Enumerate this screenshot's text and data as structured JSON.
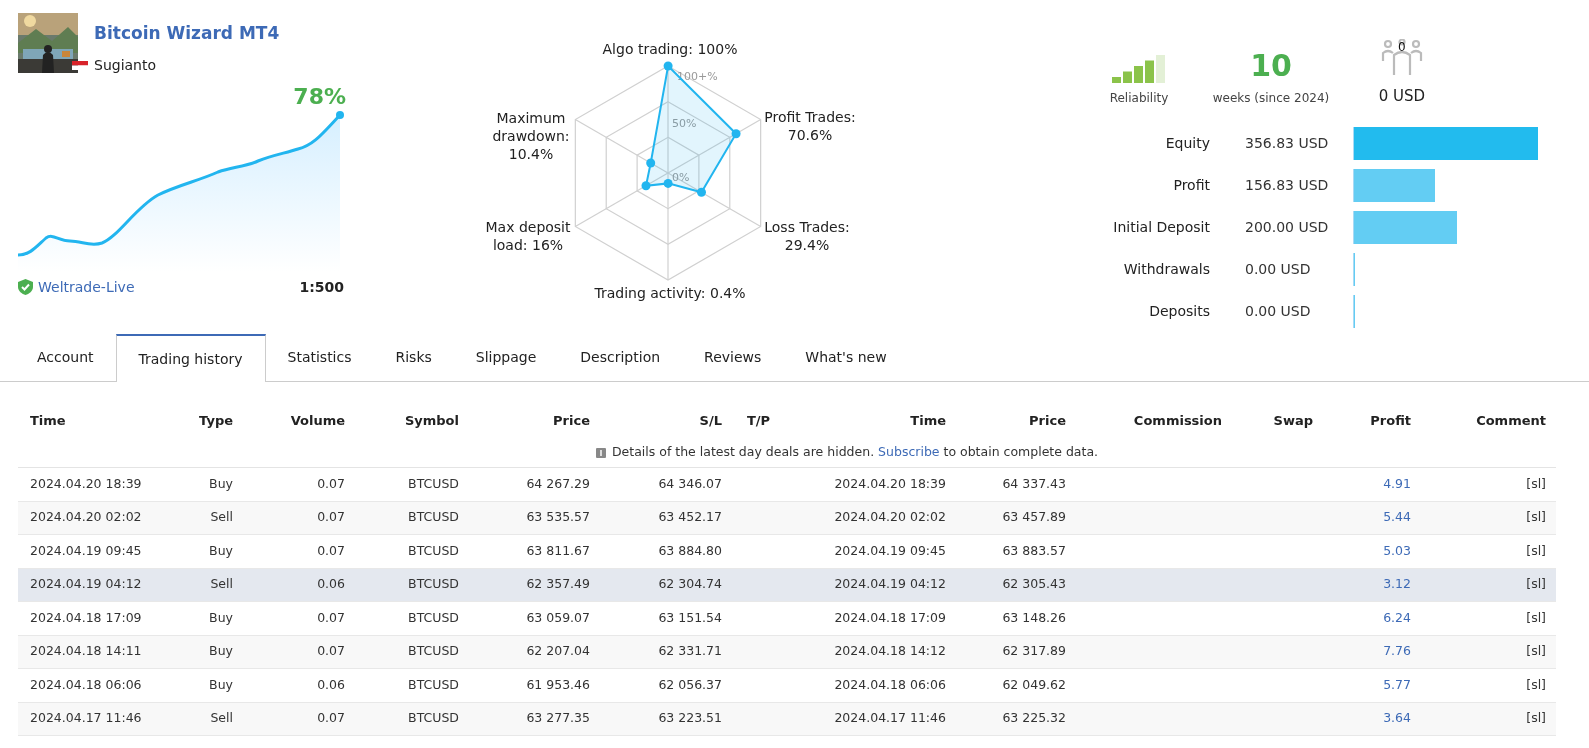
{
  "signal": {
    "title": "Bitcoin Wizard MT4",
    "author": "Sugianto",
    "growth": "78%",
    "server": "Weltrade-Live",
    "leverage": "1:500"
  },
  "radar": {
    "scale_labels": [
      "100+%",
      "50%",
      "0%"
    ],
    "axes": [
      {
        "label": "Algo trading: 100%"
      },
      {
        "label": "Maximum drawdown: 10.4%"
      },
      {
        "label": "Profit Trades: 70.6%"
      },
      {
        "label": "Max deposit load: 16%"
      },
      {
        "label": "Loss Trades: 29.4%"
      },
      {
        "label": "Trading activity: 0.4%"
      }
    ]
  },
  "stats": {
    "reliability": "Reliability",
    "weeks": "10",
    "weeks_label": "weeks (since 2024)",
    "subscribers": "0",
    "subscribers_amount": "0 USD"
  },
  "balances": [
    {
      "label": "Equity",
      "value": "356.83 USD",
      "level": 1.0,
      "color": "#22bbee"
    },
    {
      "label": "Profit",
      "value": "156.83 USD",
      "level": 0.44,
      "color": "#63cdf3"
    },
    {
      "label": "Initial Deposit",
      "value": "200.00 USD",
      "level": 0.56,
      "color": "#63cdf3"
    },
    {
      "label": "Withdrawals",
      "value": "0.00 USD",
      "level": 0,
      "color": "#63cdf3"
    },
    {
      "label": "Deposits",
      "value": "0.00 USD",
      "level": 0,
      "color": "#63cdf3"
    }
  ],
  "tabs": [
    {
      "label": "Account",
      "selected": false
    },
    {
      "label": "Trading history",
      "selected": true
    },
    {
      "label": "Statistics",
      "selected": false
    },
    {
      "label": "Risks",
      "selected": false
    },
    {
      "label": "Slippage",
      "selected": false
    },
    {
      "label": "Description",
      "selected": false
    },
    {
      "label": "Reviews",
      "selected": false
    },
    {
      "label": "What's new",
      "selected": false
    }
  ],
  "table": {
    "columns": [
      "Time",
      "Type",
      "Volume",
      "Symbol",
      "Price",
      "S/L",
      "T/P",
      "Time",
      "Price",
      "Commission",
      "Swap",
      "Profit",
      "Comment"
    ],
    "notice": {
      "before": "Details of the latest day deals are hidden.",
      "link": "Subscribe",
      "after": "to obtain complete data."
    },
    "rows": [
      {
        "selected": false,
        "cells": [
          "2024.04.20 18:39",
          "Buy",
          "0.07",
          "BTCUSD",
          "64 267.29",
          "64 346.07",
          "",
          "2024.04.20 18:39",
          "64 337.43",
          "",
          "",
          "4.91",
          "[sl]"
        ]
      },
      {
        "selected": false,
        "cells": [
          "2024.04.20 02:02",
          "Sell",
          "0.07",
          "BTCUSD",
          "63 535.57",
          "63 452.17",
          "",
          "2024.04.20 02:02",
          "63 457.89",
          "",
          "",
          "5.44",
          "[sl]"
        ]
      },
      {
        "selected": false,
        "cells": [
          "2024.04.19 09:45",
          "Buy",
          "0.07",
          "BTCUSD",
          "63 811.67",
          "63 884.80",
          "",
          "2024.04.19 09:45",
          "63 883.57",
          "",
          "",
          "5.03",
          "[sl]"
        ]
      },
      {
        "selected": true,
        "cells": [
          "2024.04.19 04:12",
          "Sell",
          "0.06",
          "BTCUSD",
          "62 357.49",
          "62 304.74",
          "",
          "2024.04.19 04:12",
          "62 305.43",
          "",
          "",
          "3.12",
          "[sl]"
        ]
      },
      {
        "selected": false,
        "cells": [
          "2024.04.18 17:09",
          "Buy",
          "0.07",
          "BTCUSD",
          "63 059.07",
          "63 151.54",
          "",
          "2024.04.18 17:09",
          "63 148.26",
          "",
          "",
          "6.24",
          "[sl]"
        ]
      },
      {
        "selected": false,
        "cells": [
          "2024.04.18 14:11",
          "Buy",
          "0.07",
          "BTCUSD",
          "62 207.04",
          "62 331.71",
          "",
          "2024.04.18 14:12",
          "62 317.89",
          "",
          "",
          "7.76",
          "[sl]"
        ]
      },
      {
        "selected": false,
        "cells": [
          "2024.04.18 06:06",
          "Buy",
          "0.06",
          "BTCUSD",
          "61 953.46",
          "62 056.37",
          "",
          "2024.04.18 06:06",
          "62 049.62",
          "",
          "",
          "5.77",
          "[sl]"
        ]
      },
      {
        "selected": false,
        "cells": [
          "2024.04.17 11:46",
          "Sell",
          "0.07",
          "BTCUSD",
          "63 277.35",
          "63 223.51",
          "",
          "2024.04.17 11:46",
          "63 225.32",
          "",
          "",
          "3.64",
          "[sl]"
        ]
      }
    ]
  }
}
